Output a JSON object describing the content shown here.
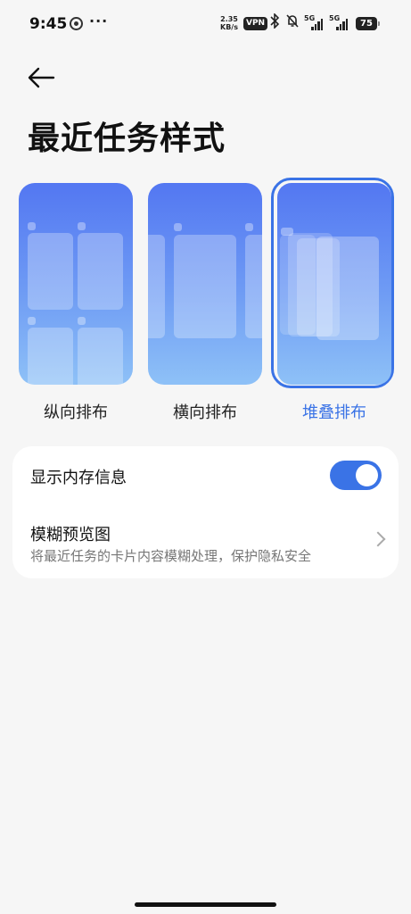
{
  "status_bar": {
    "time": "9:45",
    "more": "···",
    "net_speed_value": "2.35",
    "net_speed_unit": "KB/s",
    "vpn": "VPN",
    "sim1_label": "5G",
    "sim2_label": "5G",
    "battery": "75",
    "icons": [
      "app-icon",
      "bluetooth-icon",
      "mute-bell-icon",
      "signal-icon",
      "signal-icon",
      "battery-icon"
    ]
  },
  "header": {
    "title": "最近任务样式",
    "back_icon": "arrow-left-icon"
  },
  "layout_options": [
    {
      "label": "纵向排布",
      "selected": false
    },
    {
      "label": "横向排布",
      "selected": false
    },
    {
      "label": "堆叠排布",
      "selected": true
    }
  ],
  "settings": {
    "show_memory": {
      "label": "显示内存信息",
      "enabled": true
    },
    "blur_preview": {
      "label": "模糊预览图",
      "description": "将最近任务的卡片内容模糊处理，保护隐私安全"
    }
  },
  "colors": {
    "accent": "#3a73e6",
    "background": "#f6f6f6",
    "card": "#ffffff"
  }
}
